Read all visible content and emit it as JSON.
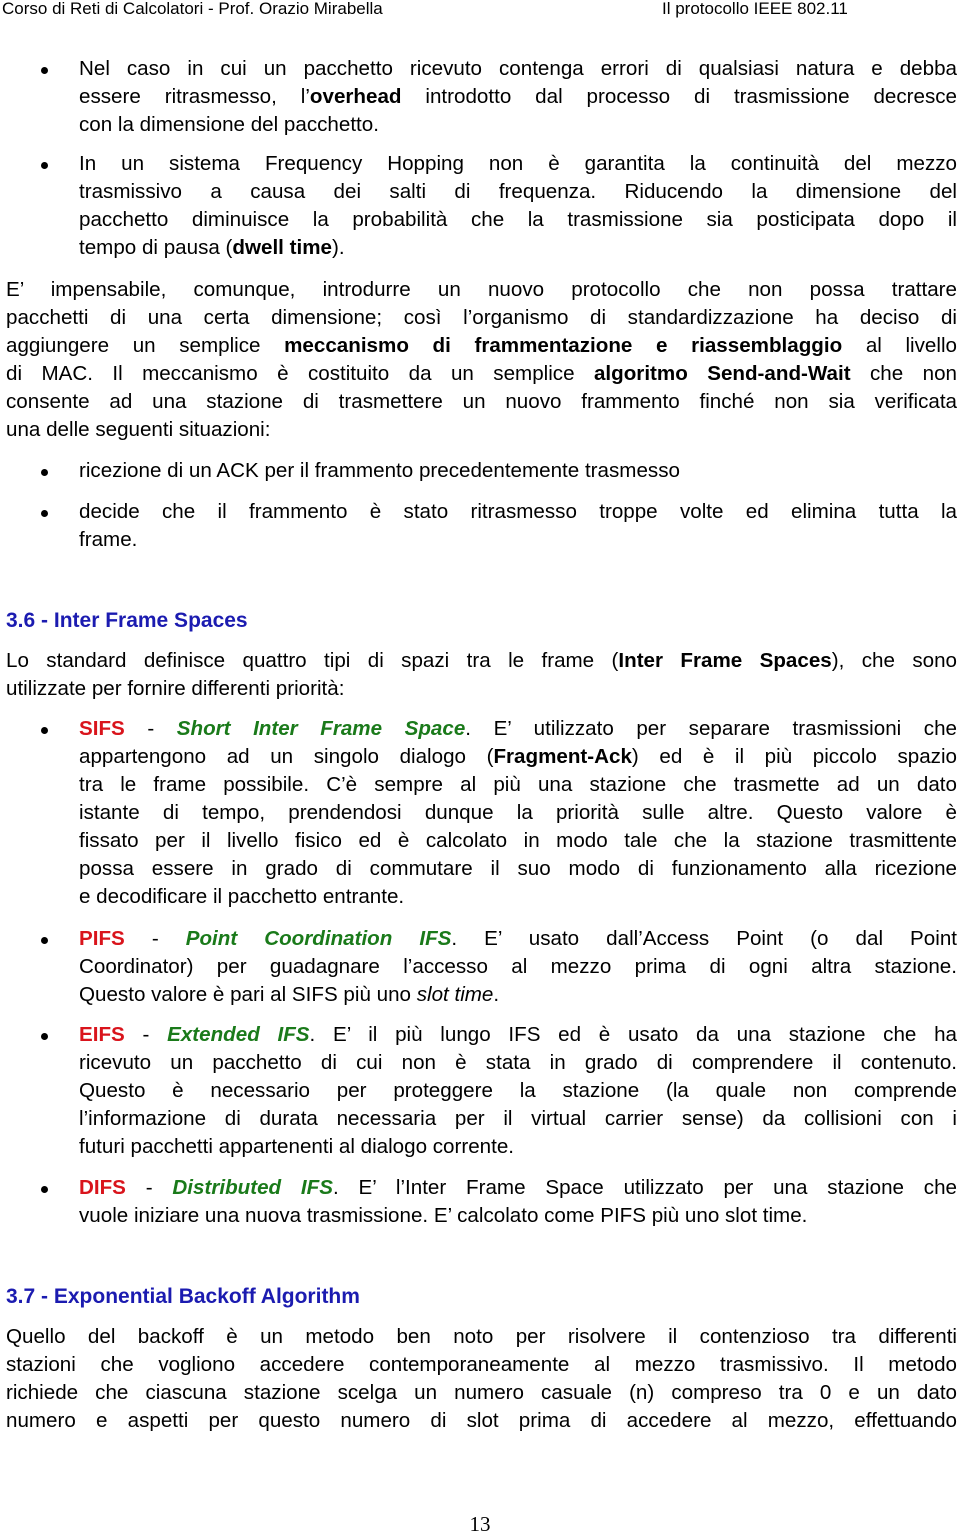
{
  "header": {
    "left": "Corso di Reti di Calcolatori - Prof. Orazio Mirabella",
    "right": "Il protocollo IEEE 802.11"
  },
  "bullets_top": [
    {
      "lines": [
        [
          "Nel caso in cui un pacchetto ricevuto contenga errori di qualsiasi natura e debba"
        ],
        [
          "essere ritrasmesso, l’",
          {
            "b": "overhead"
          },
          " introdotto dal processo di trasmissione decresce"
        ],
        [
          "con la dimensione del pacchetto."
        ]
      ]
    },
    {
      "lines": [
        [
          "In un sistema Frequency Hopping non è garantita la continuità del mezzo"
        ],
        [
          "trasmissivo a causa dei salti di frequenza. Riducendo la dimensione del"
        ],
        [
          "pacchetto diminuisce la probabilità che la trasmissione sia posticipata dopo il"
        ],
        [
          "tempo di pausa (",
          {
            "b": "dwell time"
          },
          ")."
        ]
      ]
    }
  ],
  "paragraph_fragmentation": {
    "lines": [
      [
        "E’ impensabile, comunque, introdurre un nuovo protocollo che non possa trattare"
      ],
      [
        "pacchetti di una certa dimensione; così l’organismo di standardizzazione ha deciso di"
      ],
      [
        "aggiungere un semplice ",
        {
          "b": "meccanismo di frammentazione e riassemblaggio"
        },
        " al livello"
      ],
      [
        "di MAC. Il meccanismo è costituito da un semplice ",
        {
          "b": "algoritmo Send-and-Wait"
        },
        " che non"
      ],
      [
        "consente ad una stazione di trasmettere un nuovo frammento finché non sia verificata"
      ],
      [
        "una delle seguenti situazioni:"
      ]
    ]
  },
  "bullets_conditions": [
    {
      "lines": [
        [
          "ricezione di un ACK per il frammento precedentemente trasmesso"
        ]
      ]
    },
    {
      "lines": [
        [
          "decide che il frammento è stato ritrasmesso troppe volte ed elimina tutta la"
        ],
        [
          "frame."
        ]
      ]
    }
  ],
  "section_ifs": {
    "heading": "3.6 - Inter Frame Spaces",
    "intro_lines": [
      [
        "Lo standard definisce quattro tipi di spazi tra le frame (",
        {
          "b": "Inter Frame Spaces"
        },
        "), che sono"
      ],
      [
        "utilizzate per fornire differenti priorità:"
      ]
    ],
    "items": [
      {
        "lines": [
          [
            {
              "r": "SIFS"
            },
            " - ",
            {
              "g": "Short Inter Frame Space"
            },
            ". E’ utilizzato per separare trasmissioni che"
          ],
          [
            "appartengono ad un singolo dialogo (",
            {
              "b": "Fragment-Ack"
            },
            ") ed è il più piccolo spazio"
          ],
          [
            "tra le frame possibile. C’è sempre al più una stazione che trasmette ad un dato"
          ],
          [
            "istante di tempo, prendendosi dunque la priorità sulle altre. Questo valore è"
          ],
          [
            "fissato per il livello fisico ed è calcolato in modo tale che la stazione trasmittente"
          ],
          [
            "possa essere in grado di commutare il suo modo di funzionamento alla ricezione"
          ],
          [
            "e decodificare il pacchetto entrante."
          ]
        ]
      },
      {
        "lines": [
          [
            {
              "r": "PIFS"
            },
            " - ",
            {
              "g": "Point Coordination IFS"
            },
            ". E’ usato dall’Access Point (o dal Point"
          ],
          [
            "Coordinator) per guadagnare l’accesso al mezzo prima di ogni altra stazione."
          ],
          [
            "Questo valore è pari al SIFS più uno ",
            {
              "i": "slot time"
            },
            "."
          ]
        ]
      },
      {
        "lines": [
          [
            {
              "r": "EIFS"
            },
            " - ",
            {
              "g": "Extended IFS"
            },
            ". E’ il più lungo IFS ed è usato da una stazione che ha"
          ],
          [
            "ricevuto un pacchetto di cui non è stata in grado di comprendere il contenuto."
          ],
          [
            "Questo è necessario per proteggere la stazione (la quale non comprende"
          ],
          [
            "l’informazione di durata necessaria per il virtual carrier sense) da collisioni con i"
          ],
          [
            "futuri pacchetti appartenenti al dialogo corrente."
          ]
        ]
      },
      {
        "lines": [
          [
            {
              "r": "DIFS"
            },
            " - ",
            {
              "g": "Distributed IFS"
            },
            ". E’ l’Inter Frame Space utilizzato per una stazione che"
          ],
          [
            "vuole iniziare una nuova trasmissione. E’ calcolato come PIFS più uno slot time."
          ]
        ]
      }
    ]
  },
  "section_backoff": {
    "heading": "3.7 - Exponential Backoff Algorithm",
    "lines": [
      [
        "Quello del backoff è un metodo ben noto per risolvere il contenzioso tra differenti"
      ],
      [
        "stazioni che vogliono accedere contemporaneamente al mezzo trasmissivo. Il metodo"
      ],
      [
        "richiede che ciascuna stazione scelga un numero casuale (n) compreso tra 0 e un dato"
      ],
      [
        "numero e aspetti per questo numero di slot prima di accedere al mezzo, effettuando"
      ]
    ],
    "last_line_continues": true
  },
  "page_number": "13",
  "colors": {
    "heading": "#1b1bb0",
    "ifs_acronym": "#d9141c",
    "ifs_name": "#1a7a1a",
    "text": "#000000"
  }
}
